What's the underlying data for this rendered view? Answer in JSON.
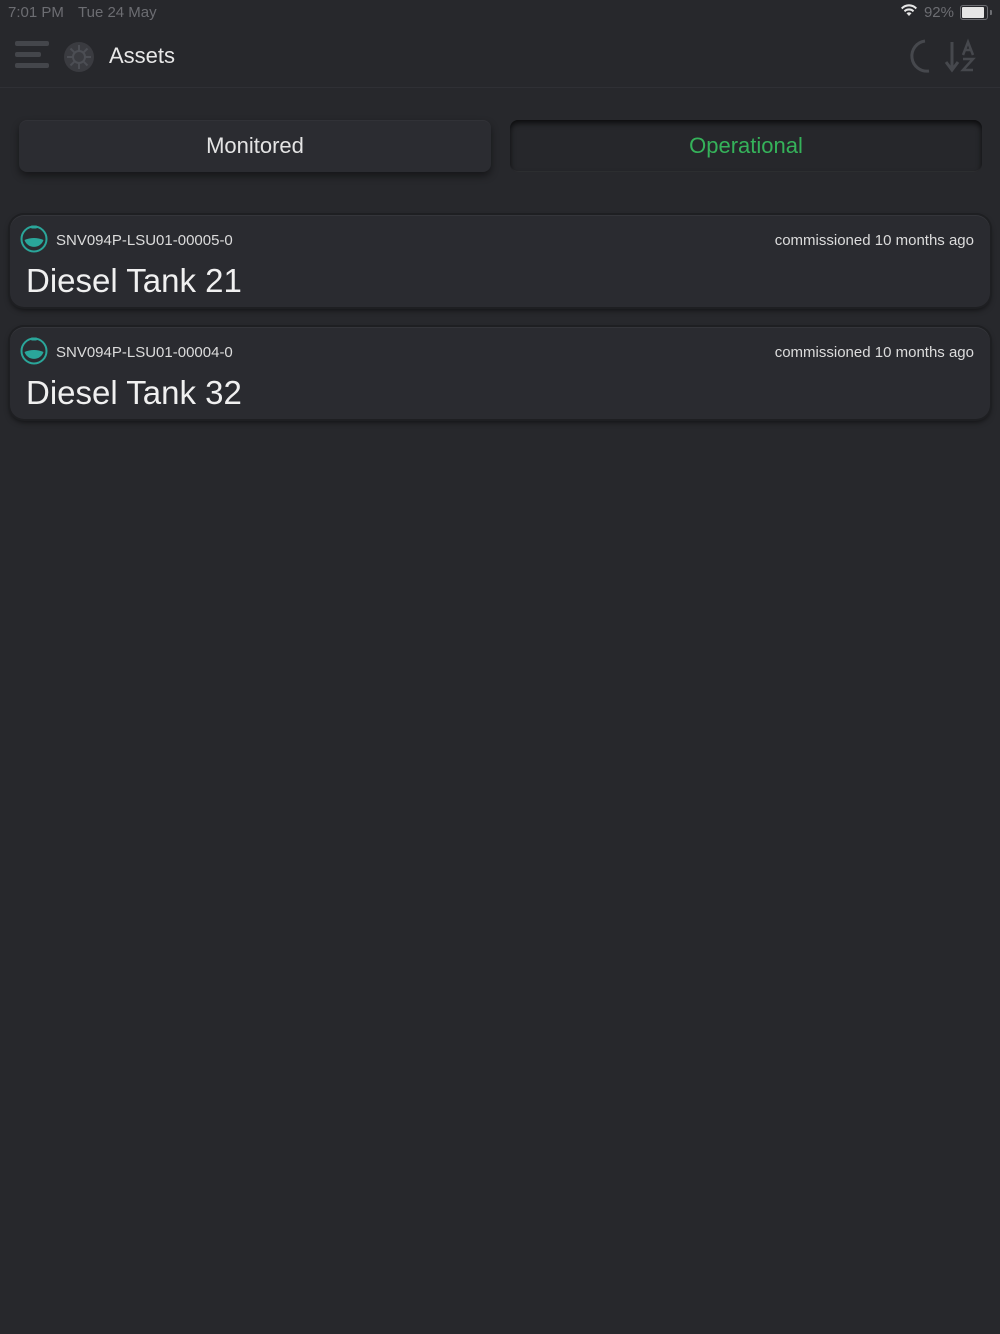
{
  "status_bar": {
    "time": "7:01 PM",
    "date": "Tue 24 May",
    "battery": "92%",
    "battery_level": 0.92
  },
  "header": {
    "title": "Assets",
    "icons": [
      "menu-icon",
      "logo-icon",
      "moon-icon",
      "sort-az-icon"
    ]
  },
  "tabs": [
    {
      "label": "Monitored",
      "active": false
    },
    {
      "label": "Operational",
      "active": true
    }
  ],
  "colors": {
    "background": "#27282c",
    "accent_green": "#35b25a",
    "tank_teal": "#2aa69a"
  },
  "assets": [
    {
      "serial": "SNV094P-LSU01-00005-0",
      "commissioned": "commissioned 10 months ago",
      "name": "Diesel Tank 21",
      "icon": "tank-level-icon"
    },
    {
      "serial": "SNV094P-LSU01-00004-0",
      "commissioned": "commissioned 10 months ago",
      "name": "Diesel Tank 32",
      "icon": "tank-level-icon"
    }
  ]
}
